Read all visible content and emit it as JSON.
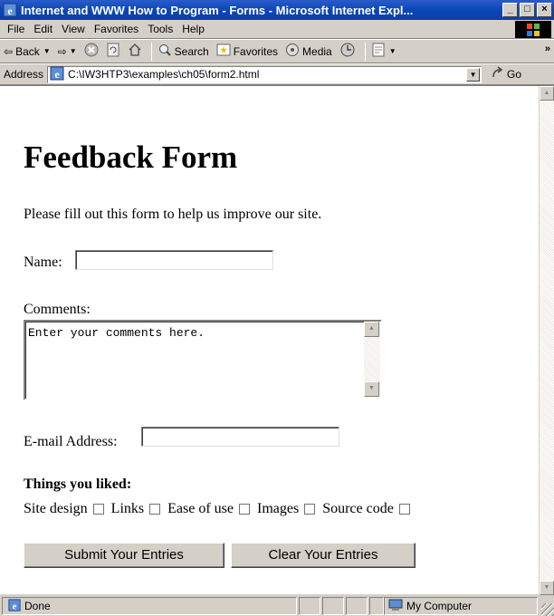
{
  "window": {
    "title": "Internet and WWW How to Program - Forms - Microsoft Internet Expl...",
    "buttons": {
      "minimize": "_",
      "maximize": "□",
      "close": "×"
    }
  },
  "menu": {
    "items": [
      "File",
      "Edit",
      "View",
      "Favorites",
      "Tools",
      "Help"
    ]
  },
  "toolbar": {
    "back": "Back",
    "search": "Search",
    "favorites": "Favorites",
    "media": "Media",
    "more": "»"
  },
  "address": {
    "label": "Address",
    "url": "C:\\IW3HTP3\\examples\\ch05\\form2.html",
    "go": "Go"
  },
  "page": {
    "heading": "Feedback Form",
    "intro": "Please fill out this form to help us improve our site.",
    "name_label": "Name:",
    "name_value": "",
    "comments_label": "Comments:",
    "comments_value": "Enter your comments here.",
    "email_label": "E-mail Address:",
    "email_value": "",
    "liked_heading": "Things you liked:",
    "checkboxes": [
      {
        "label": "Site design",
        "checked": false
      },
      {
        "label": "Links",
        "checked": false
      },
      {
        "label": "Ease of use",
        "checked": false
      },
      {
        "label": "Images",
        "checked": false
      },
      {
        "label": "Source code",
        "checked": false
      }
    ],
    "submit_label": "Submit Your Entries",
    "reset_label": "Clear Your Entries"
  },
  "status": {
    "text": "Done",
    "zone": "My Computer"
  }
}
